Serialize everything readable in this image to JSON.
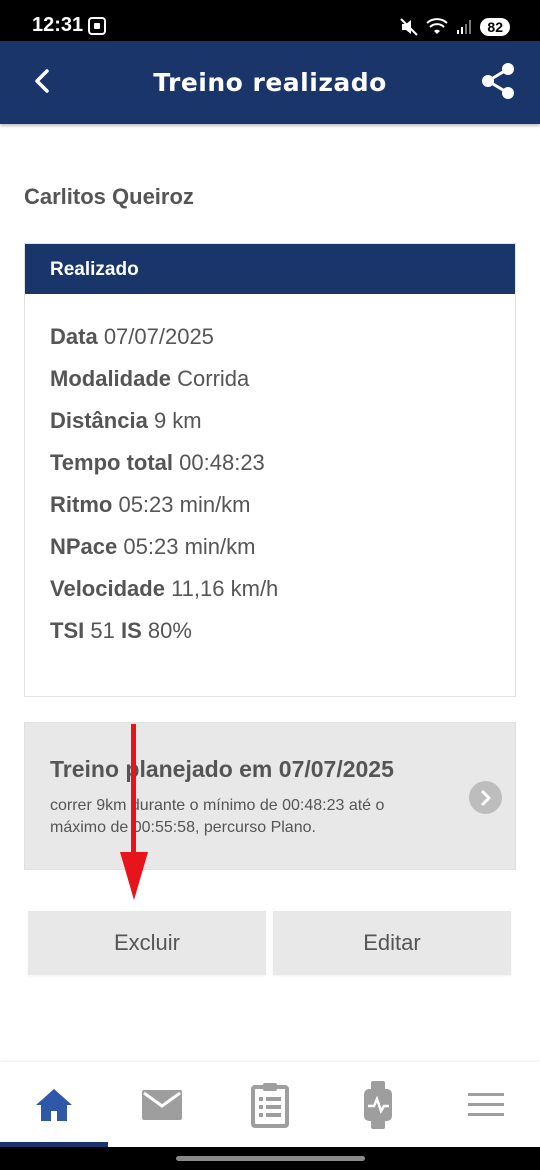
{
  "status_bar": {
    "time": "12:31",
    "battery": "82"
  },
  "app_bar": {
    "title": "Treino realizado"
  },
  "athlete_name": "Carlitos Queiroz",
  "realizado": {
    "header": "Realizado",
    "rows": [
      {
        "label": "Data",
        "value": "07/07/2025"
      },
      {
        "label": "Modalidade",
        "value": "Corrida"
      },
      {
        "label": "Distância",
        "value": "9 km"
      },
      {
        "label": "Tempo total",
        "value": "00:48:23"
      },
      {
        "label": "Ritmo",
        "value": "05:23 min/km"
      },
      {
        "label": "NPace",
        "value": "05:23 min/km"
      },
      {
        "label": "Velocidade",
        "value": "11,16 km/h"
      }
    ],
    "tsi_label": "TSI",
    "tsi_value": "51",
    "is_label": "IS",
    "is_value": "80%"
  },
  "planned": {
    "title": "Treino planejado em 07/07/2025",
    "description": "correr 9km durante o mínimo de 00:48:23 até o máximo de 00:55:58, percurso Plano."
  },
  "actions": {
    "delete_label": "Excluir",
    "edit_label": "Editar"
  },
  "bottom_nav": {
    "active_index": 0,
    "items": [
      "home-icon",
      "mail-icon",
      "clipboard-icon",
      "smartwatch-icon",
      "menu-icon"
    ]
  },
  "colors": {
    "primary": "#1a3569",
    "accent_arrow": "#e8141b",
    "nav_active": "#2f59a8",
    "nav_inactive": "#9e9e9e"
  }
}
